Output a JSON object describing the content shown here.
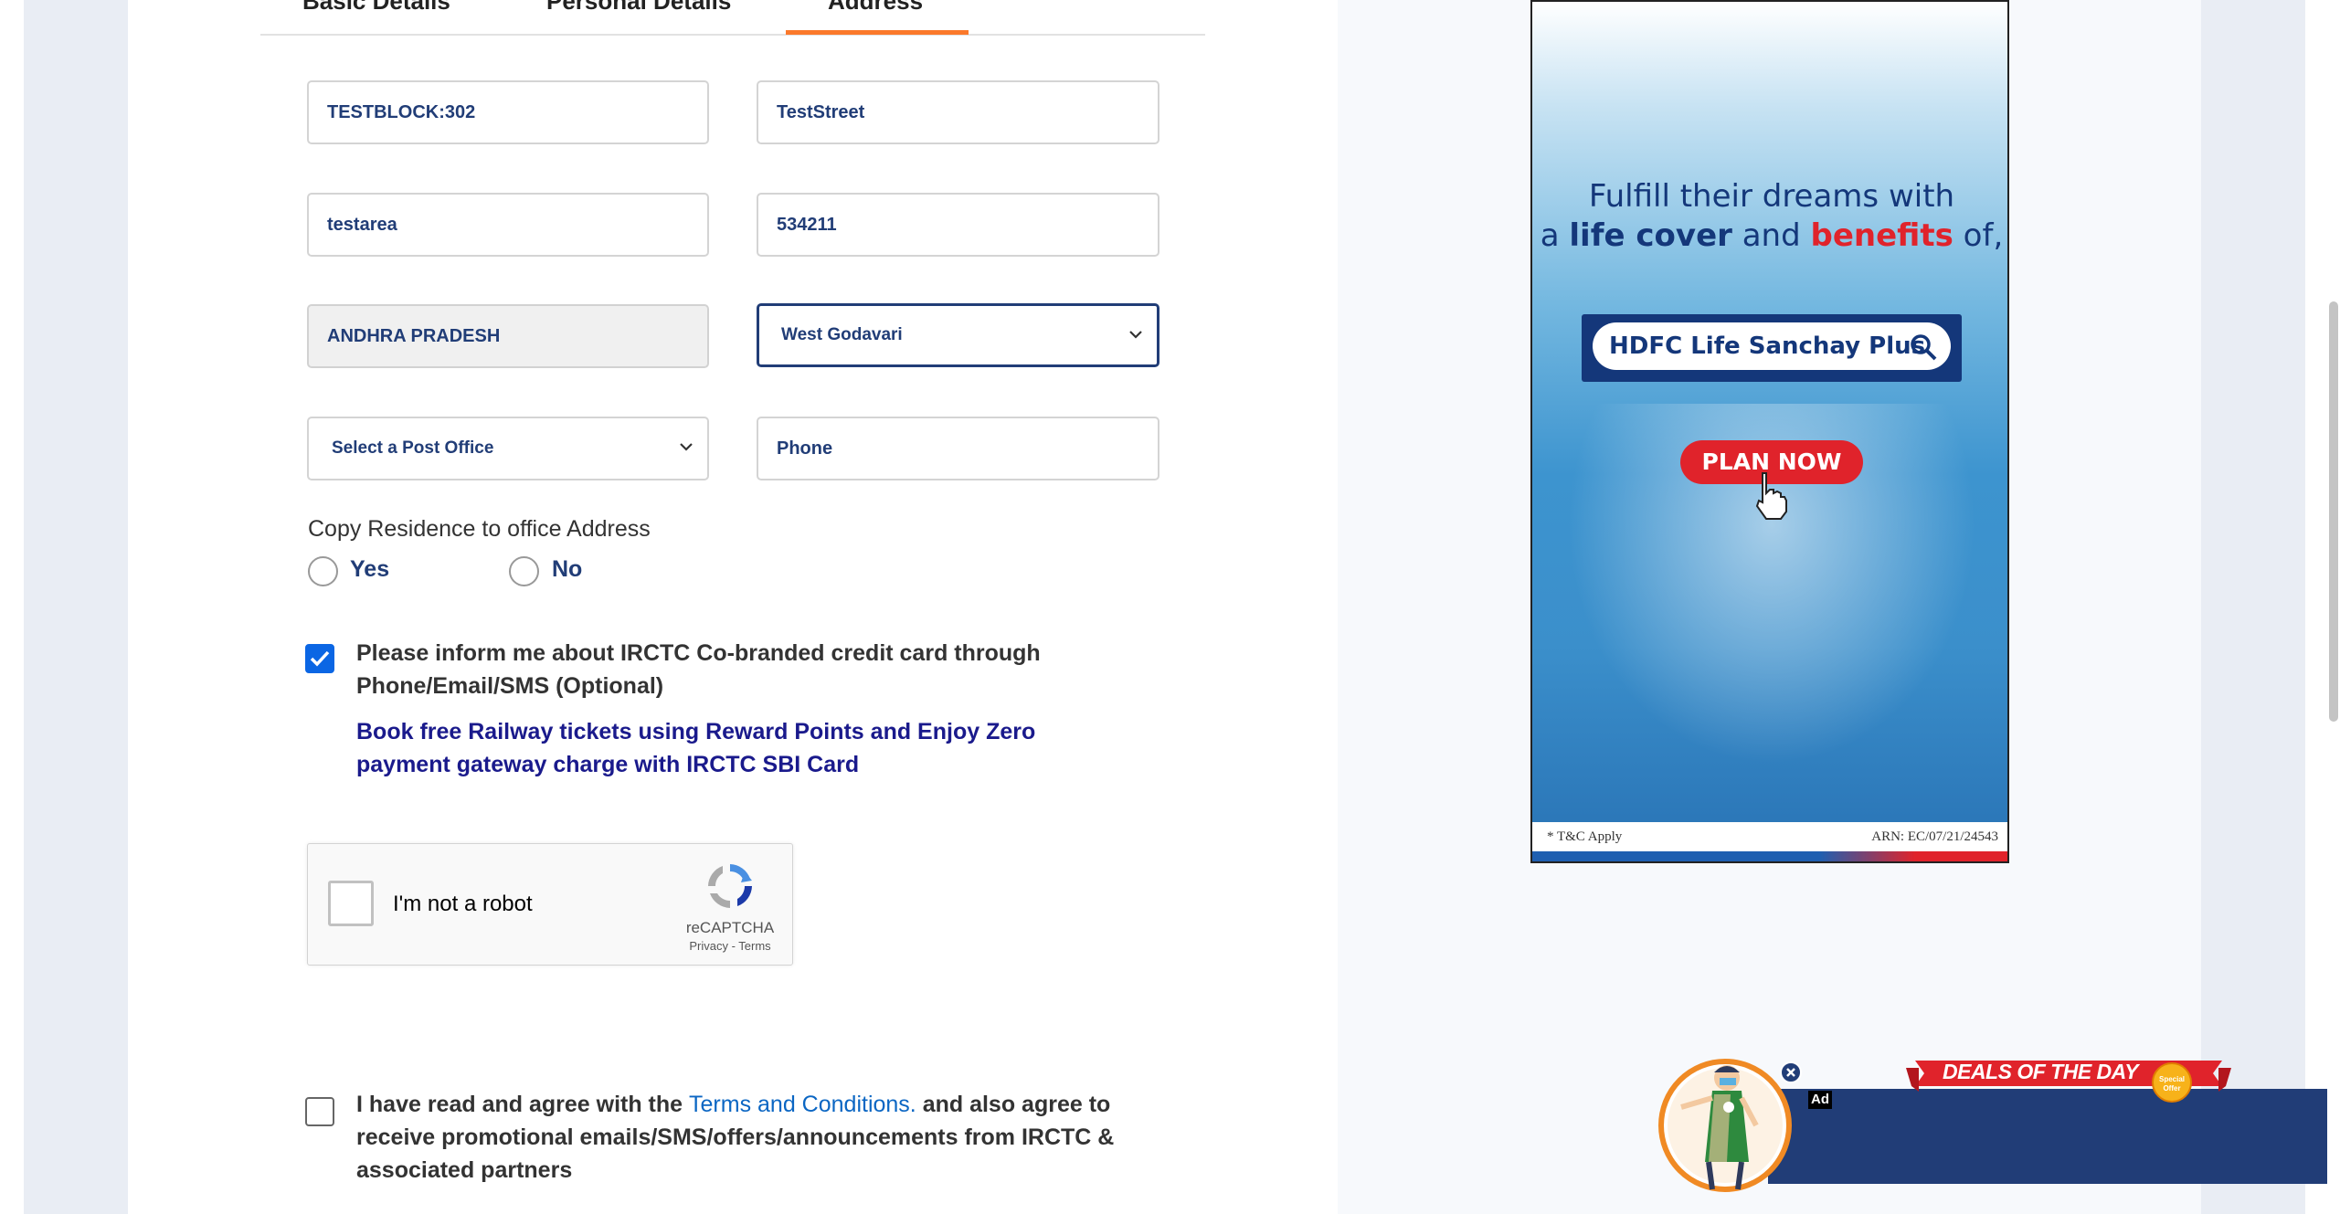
{
  "tabs": [
    {
      "label": "Basic Details"
    },
    {
      "label": "Personal Details"
    },
    {
      "label": "Address"
    }
  ],
  "address": {
    "flat": "TESTBLOCK:302",
    "street": "TestStreet",
    "area": "testarea",
    "pincode": "534211",
    "state": "ANDHRA PRADESH",
    "district": "West Godavari",
    "post_office": "Select a Post Office",
    "phone_placeholder": "Phone"
  },
  "copy_residence": {
    "label": "Copy Residence to office Address",
    "yes": "Yes",
    "no": "No"
  },
  "inform": {
    "text": "Please inform me about IRCTC Co-branded credit card through Phone/Email/SMS (Optional)",
    "checked": true,
    "sbi_link": "Book free Railway tickets using Reward Points and Enjoy Zero payment gateway charge with IRCTC SBI Card"
  },
  "recaptcha": {
    "label": "I'm not a robot",
    "brand": "reCAPTCHA",
    "privacy": "Privacy",
    "separator": " - ",
    "terms": "Terms"
  },
  "agree": {
    "prefix": "I have read and agree with the ",
    "link": "Terms and Conditions.",
    "suffix": " and also agree to receive promotional emails/SMS/offers/announcements from IRCTC & associated partners"
  },
  "ad": {
    "line1": "Fulfill their dreams with",
    "line2_a": "a ",
    "line2_b": "life cover",
    "line2_c": " and ",
    "line2_d": "benefits",
    "line2_e": " of,",
    "search_text": "HDFC Life Sanchay Plus",
    "cta": "PLAN NOW",
    "footer_left": "* T&C Apply",
    "footer_right": "ARN: EC/07/21/24543"
  },
  "deals": {
    "title": "DEALS OF THE DAY",
    "badge": "Special Offer",
    "ad_tag": "Ad"
  },
  "colors": {
    "accent": "#fb792b",
    "navy": "#213d77",
    "checkbox_blue": "#0b66e4",
    "ad_red": "#e0232b"
  }
}
